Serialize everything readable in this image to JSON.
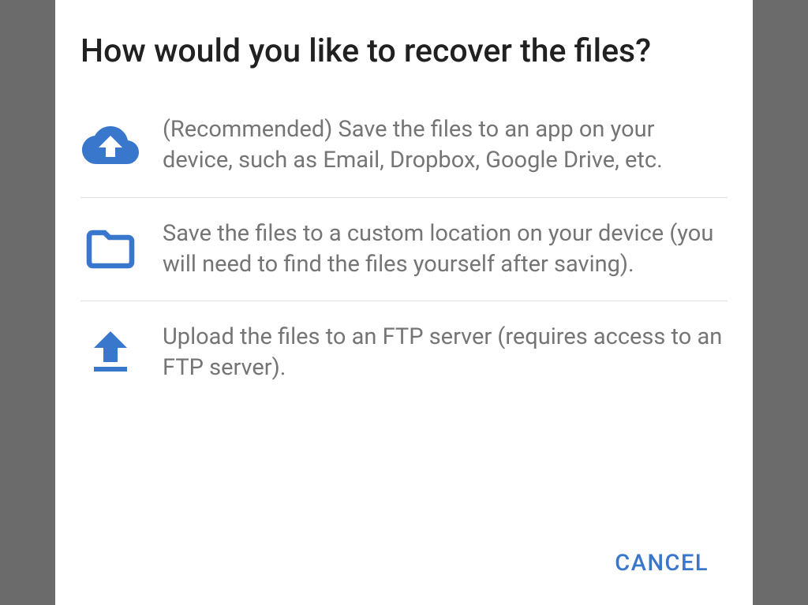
{
  "dialog": {
    "title": "How would you like to recover the files?",
    "options": [
      {
        "icon": "cloud-upload-icon",
        "text": "(Recommended) Save the files to an app on your device, such as Email, Dropbox, Google Drive, etc."
      },
      {
        "icon": "folder-icon",
        "text": "Save the files to a custom location on your device (you will need to find the files yourself after saving)."
      },
      {
        "icon": "upload-icon",
        "text": "Upload the files to an FTP server (requires access to an FTP server)."
      }
    ],
    "cancel_label": "CANCEL"
  },
  "colors": {
    "accent": "#3977cc",
    "icon_blue": "#3977cc",
    "text_primary": "#212121",
    "text_secondary": "#757575"
  }
}
